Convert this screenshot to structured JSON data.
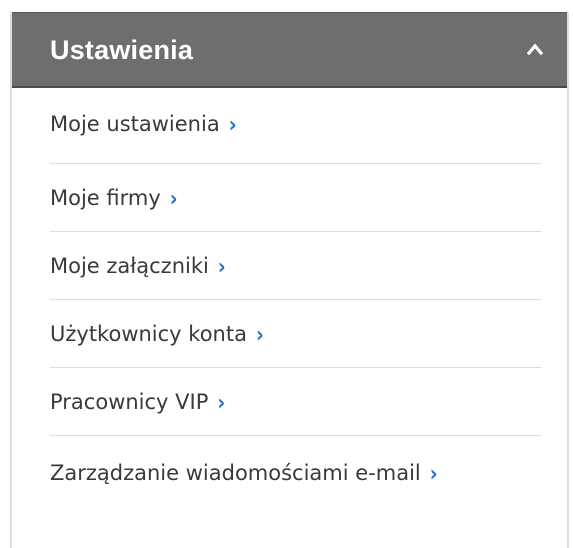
{
  "header": {
    "title": "Ustawienia",
    "toggle_icon": "chevron-up-icon"
  },
  "menu": {
    "items": [
      {
        "label": "Moje ustawienia"
      },
      {
        "label": "Moje firmy"
      },
      {
        "label": "Moje załączniki"
      },
      {
        "label": "Użytkownicy konta"
      },
      {
        "label": "Pracownicy VIP"
      },
      {
        "label": "Zarządzanie wiadomościami e-mail"
      }
    ],
    "arrow_glyph": "›"
  },
  "colors": {
    "header_bg": "#6e6e6e",
    "header_text": "#ffffff",
    "item_text": "#3a3a3a",
    "arrow": "#1f6fc6",
    "divider": "#e2dbd5"
  }
}
